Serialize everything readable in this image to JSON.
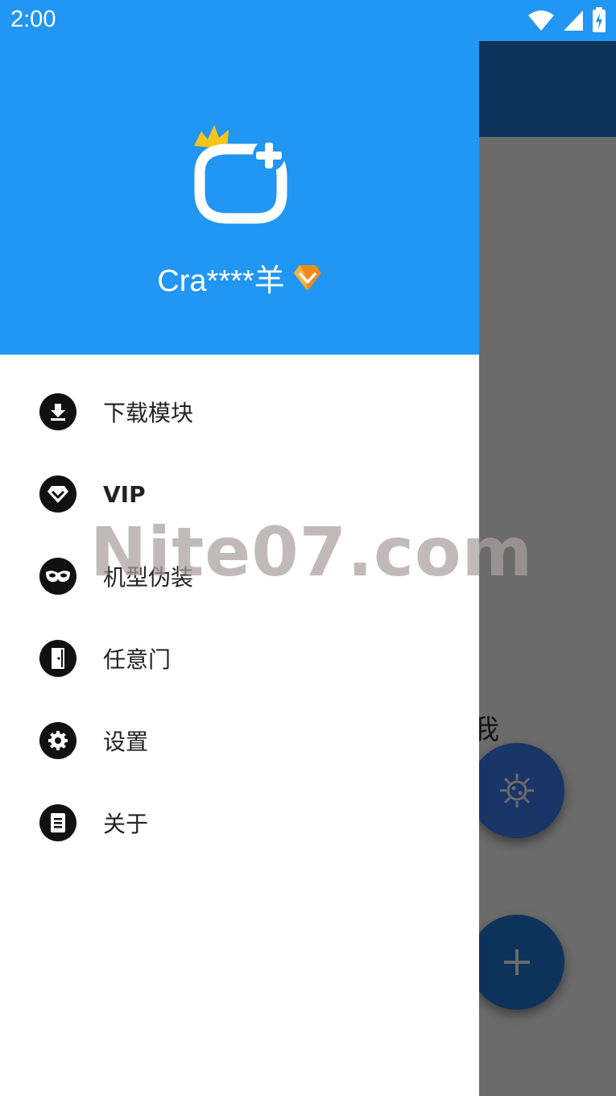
{
  "status_bar": {
    "time": "2:00",
    "icons": [
      "wifi-icon",
      "signal-icon",
      "battery-charging-icon"
    ]
  },
  "drawer": {
    "header": {
      "username": "Cra****羊",
      "avatar_icon": "crown-plus-logo",
      "badge_icon": "diamond-icon",
      "background_color": "#2196f3"
    },
    "menu": [
      {
        "label": "下载模块",
        "icon": "download-icon"
      },
      {
        "label": "VIP",
        "icon": "vip-diamond-icon"
      },
      {
        "label": "机型伪装",
        "icon": "mask-icon"
      },
      {
        "label": "任意门",
        "icon": "door-icon"
      },
      {
        "label": "设置",
        "icon": "gear-icon"
      },
      {
        "label": "关于",
        "icon": "document-icon"
      }
    ]
  },
  "background_screen": {
    "partial_text": "我",
    "fabs": [
      {
        "icon": "virus-icon"
      },
      {
        "icon": "plus-icon"
      }
    ]
  },
  "watermark": "Nite07.com"
}
